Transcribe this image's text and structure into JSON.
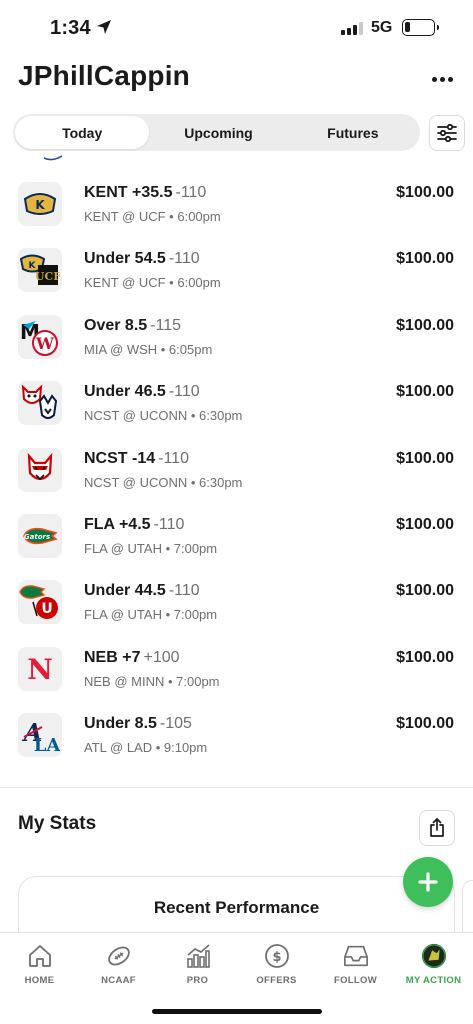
{
  "status_bar": {
    "time": "1:34",
    "network": "5G"
  },
  "header": {
    "title": "JPhillCappin"
  },
  "tabs": [
    {
      "label": "Today",
      "active": true
    },
    {
      "label": "Upcoming",
      "active": false
    },
    {
      "label": "Futures",
      "active": false
    }
  ],
  "bets": [
    {
      "title": "KENT +35.5",
      "odds": "-110",
      "matchup": "KENT @ UCF • 6:00pm",
      "amount": "$100.00",
      "logo": "kent-state-logo"
    },
    {
      "title": "Under 54.5",
      "odds": "-110",
      "matchup": "KENT @ UCF • 6:00pm",
      "amount": "$100.00",
      "logo": "kent-ucf-logo"
    },
    {
      "title": "Over 8.5",
      "odds": "-115",
      "matchup": "MIA @ WSH • 6:05pm",
      "amount": "$100.00",
      "logo": "marlins-nationals-logo"
    },
    {
      "title": "Under 46.5",
      "odds": "-110",
      "matchup": "NCST @ UCONN • 6:30pm",
      "amount": "$100.00",
      "logo": "ncst-uconn-logo"
    },
    {
      "title": "NCST -14",
      "odds": "-110",
      "matchup": "NCST @ UCONN • 6:30pm",
      "amount": "$100.00",
      "logo": "nc-state-wolf-logo"
    },
    {
      "title": "FLA +4.5",
      "odds": "-110",
      "matchup": "FLA @ UTAH • 7:00pm",
      "amount": "$100.00",
      "logo": "florida-gators-logo"
    },
    {
      "title": "Under 44.5",
      "odds": "-110",
      "matchup": "FLA @ UTAH • 7:00pm",
      "amount": "$100.00",
      "logo": "florida-utah-logo"
    },
    {
      "title": "NEB +7",
      "odds": "+100",
      "matchup": "NEB @ MINN • 7:00pm",
      "amount": "$100.00",
      "logo": "nebraska-logo"
    },
    {
      "title": "Under 8.5",
      "odds": "-105",
      "matchup": "ATL @ LAD • 9:10pm",
      "amount": "$100.00",
      "logo": "braves-dodgers-logo"
    }
  ],
  "stats": {
    "title": "My Stats",
    "card_title": "Recent Performance"
  },
  "nav": [
    {
      "label": "HOME",
      "icon": "home-icon"
    },
    {
      "label": "NCAAF",
      "icon": "football-icon"
    },
    {
      "label": "PRO",
      "icon": "bar-chart-icon"
    },
    {
      "label": "OFFERS",
      "icon": "dollar-icon"
    },
    {
      "label": "FOLLOW",
      "icon": "inbox-icon"
    },
    {
      "label": "MY ACTION",
      "icon": "avatar-icon",
      "active": true
    }
  ],
  "colors": {
    "accent_green": "#3fbf5b",
    "active_nav": "#3aa54b",
    "muted_text": "#6f6f6f"
  }
}
